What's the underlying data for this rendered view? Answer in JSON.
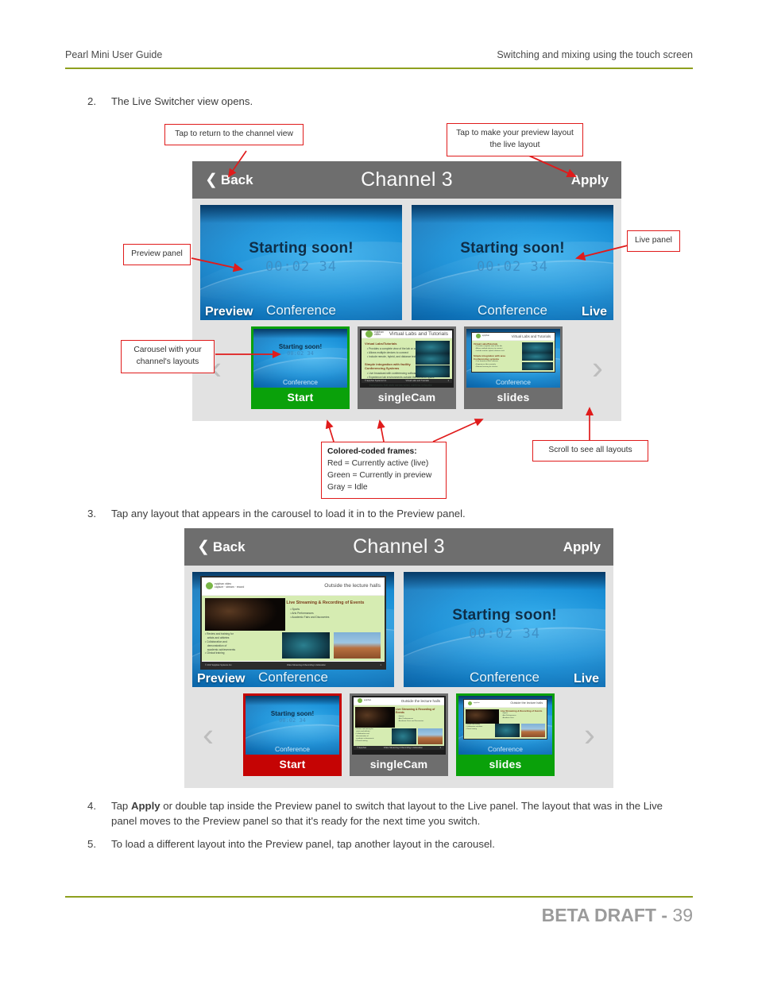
{
  "page": {
    "header_left": "Pearl Mini User Guide",
    "header_right": "Switching and mixing using the touch screen",
    "footer_label": "BETA DRAFT -",
    "footer_page": "39",
    "rule_color": "#8ea01e"
  },
  "steps": [
    {
      "num": "2.",
      "text": "The Live Switcher view opens."
    },
    {
      "num": "3.",
      "text": "Tap any layout that appears in the carousel to load it in to the Preview panel."
    },
    {
      "num": "4.",
      "text_before": "Tap ",
      "bold": "Apply",
      "text_after": " or double tap inside the Preview panel to switch that layout to the Live panel. The layout that was in the Live panel moves to the Preview panel so that it's ready for the next time you switch."
    },
    {
      "num": "5.",
      "text": "To load a different layout into the Preview panel, tap another layout in the carousel."
    }
  ],
  "callouts": {
    "back": "Tap to return to the channel view",
    "apply": "Tap to make your preview layout\nthe live layout",
    "apply_line1": "Tap to make your preview layout",
    "apply_line2": "the live layout",
    "preview_panel": "Preview panel",
    "live_panel": "Live panel",
    "carousel_line1": "Carousel with your",
    "carousel_line2": "channel's layouts",
    "frames_title": "Colored-coded frames:",
    "frames_red": "Red = Currently active (live)",
    "frames_green": "Green = Currently in preview",
    "frames_gray": "Gray = Idle",
    "scroll": "Scroll to see all layouts"
  },
  "device1": {
    "back_label": "Back",
    "title": "Channel 3",
    "apply_label": "Apply",
    "preview": {
      "badge": "Preview",
      "source": "Conference",
      "content": "starting-soon",
      "starting_title": "Starting soon!",
      "starting_timer": "00:02 34"
    },
    "live": {
      "badge": "Live",
      "source": "Conference",
      "content": "starting-soon",
      "starting_title": "Starting soon!",
      "starting_timer": "00:02 34"
    },
    "carousel": {
      "prev_arrow": "‹",
      "next_arrow": "›",
      "items": [
        {
          "name": "Start",
          "state": "green",
          "content": "starting-soon",
          "source": "Conference",
          "starting_title": "Starting soon!",
          "starting_timer": "00:02 34"
        },
        {
          "name": "singleCam",
          "state": "gray",
          "content": "slide-labs",
          "source": "",
          "slide_head": "Virtual Labs and Tutorials"
        },
        {
          "name": "slides",
          "state": "gray",
          "content": "slide-in-blue",
          "source": "Conference",
          "slide_head": "Virtual Labs and Tutorials"
        }
      ]
    }
  },
  "device2": {
    "back_label": "Back",
    "title": "Channel 3",
    "apply_label": "Apply",
    "preview": {
      "badge": "Preview",
      "source": "Conference",
      "content": "slide-lecture",
      "slide_head": "Outside the lecture halls",
      "slide_title": "Live Streaming & Recording of Events",
      "slide_bullets": [
        "Sports",
        "Arts Performances",
        "Academic Fairs and Discoveries"
      ],
      "slide_bullets2": [
        "Review and training for artists and athletes",
        "Collaboration and demonstration of academic achievements",
        "Clinical training"
      ],
      "slide_footer_left": "© 2017 Epiphan Systems Inc.",
      "slide_footer_mid": "Video Streaming & Recording in Education"
    },
    "live": {
      "badge": "Live",
      "source": "Conference",
      "content": "starting-soon",
      "starting_title": "Starting soon!",
      "starting_timer": "00:02 34"
    },
    "carousel": {
      "prev_arrow": "‹",
      "next_arrow": "›",
      "items": [
        {
          "name": "Start",
          "state": "red",
          "content": "starting-soon",
          "source": "Conference",
          "starting_title": "Starting soon!",
          "starting_timer": "00:02 34"
        },
        {
          "name": "singleCam",
          "state": "gray",
          "content": "slide-lecture",
          "source": "",
          "slide_head": "Outside the lecture halls"
        },
        {
          "name": "slides",
          "state": "green",
          "content": "slide-in-blue",
          "source": "Conference",
          "slide_head": "Outside the lecture halls"
        }
      ]
    }
  },
  "colors": {
    "accent_rule": "#8ea01e",
    "topbar": "#6e6e6e",
    "device_bg": "#e2e2e2",
    "live_red": "#c50404",
    "preview_green": "#0aa10a",
    "idle_gray": "#6e6e6e",
    "callout_border": "#e01b1b"
  }
}
